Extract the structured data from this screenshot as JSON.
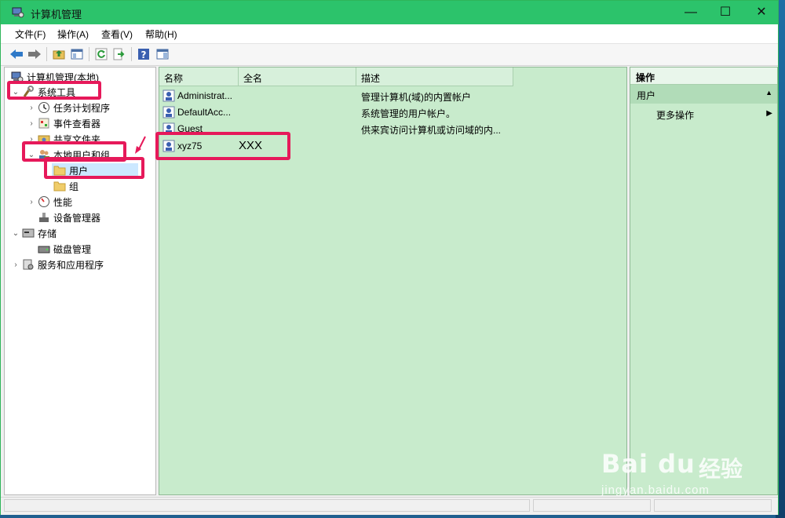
{
  "window": {
    "title": "计算机管理",
    "minimize": "—",
    "maximize": "☐",
    "close": "✕"
  },
  "menu": [
    "文件(F)",
    "操作(A)",
    "查看(V)",
    "帮助(H)"
  ],
  "toolbar": {
    "buttons": [
      "back-arrow-icon",
      "forward-arrow-icon",
      "up-folder-icon",
      "show-hide-tree-icon",
      "refresh-icon",
      "export-list-icon",
      "help-icon",
      "properties-pane-icon"
    ]
  },
  "tree": {
    "root": "计算机管理(本地)",
    "system_tools": "系统工具",
    "task_scheduler": "任务计划程序",
    "event_viewer": "事件查看器",
    "shared_folders": "共享文件夹",
    "local_users_groups": "本地用户和组",
    "users": "用户",
    "groups": "组",
    "performance": "性能",
    "device_manager": "设备管理器",
    "storage": "存储",
    "disk_management": "磁盘管理",
    "services_apps": "服务和应用程序"
  },
  "list": {
    "columns": [
      "名称",
      "全名",
      "描述"
    ],
    "rows": [
      {
        "name": "Administrat...",
        "fullname": "",
        "desc": "管理计算机(域)的内置帐户"
      },
      {
        "name": "DefaultAcc...",
        "fullname": "",
        "desc": "系统管理的用户帐户。"
      },
      {
        "name": "Guest",
        "fullname": "",
        "desc": "供来宾访问计算机或访问域的内..."
      },
      {
        "name": "xyz75",
        "fullname": "XXX",
        "desc": ""
      }
    ]
  },
  "actions": {
    "title": "操作",
    "section": "用户",
    "more": "更多操作"
  },
  "watermark": {
    "brand": "Bai du",
    "cn": "经验",
    "url": "jingyan.baidu.com"
  },
  "colors": {
    "titlebar": "#2cc36b",
    "highlight": "#e6195a",
    "pane_bg": "#c8ebcc"
  }
}
